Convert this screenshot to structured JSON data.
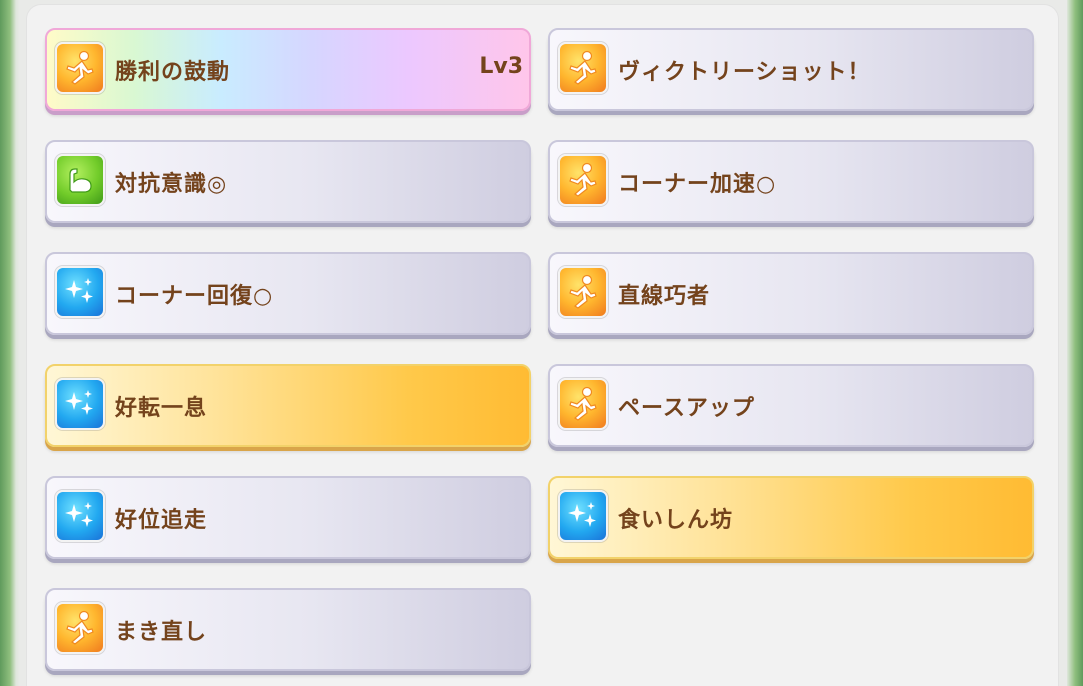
{
  "skills": [
    {
      "name": "勝利の鼓動",
      "level": "Lv3",
      "style": "rainbow",
      "icon": "running-figure-icon"
    },
    {
      "name": "ヴィクトリーショット！",
      "level": "",
      "style": "normal",
      "icon": "running-figure-icon"
    },
    {
      "name": "対抗意識◎",
      "level": "",
      "style": "normal",
      "icon": "flexed-arm-icon"
    },
    {
      "name": "コーナー加速○",
      "level": "",
      "style": "normal",
      "icon": "running-figure-icon"
    },
    {
      "name": "コーナー回復○",
      "level": "",
      "style": "normal",
      "icon": "sparkle-icon"
    },
    {
      "name": "直線巧者",
      "level": "",
      "style": "normal",
      "icon": "running-figure-icon"
    },
    {
      "name": "好転一息",
      "level": "",
      "style": "gold",
      "icon": "sparkle-icon"
    },
    {
      "name": "ペースアップ",
      "level": "",
      "style": "normal",
      "icon": "running-figure-icon"
    },
    {
      "name": "好位追走",
      "level": "",
      "style": "normal",
      "icon": "sparkle-icon"
    },
    {
      "name": "食いしん坊",
      "level": "",
      "style": "gold",
      "icon": "sparkle-icon"
    },
    {
      "name": "まき直し",
      "level": "",
      "style": "normal",
      "icon": "running-figure-icon"
    }
  ],
  "colors": {
    "label_text": "#74431c",
    "normal_card": "#e7e6f1",
    "gold_card": "#ffc94a",
    "panel": "#f2f2f2"
  }
}
